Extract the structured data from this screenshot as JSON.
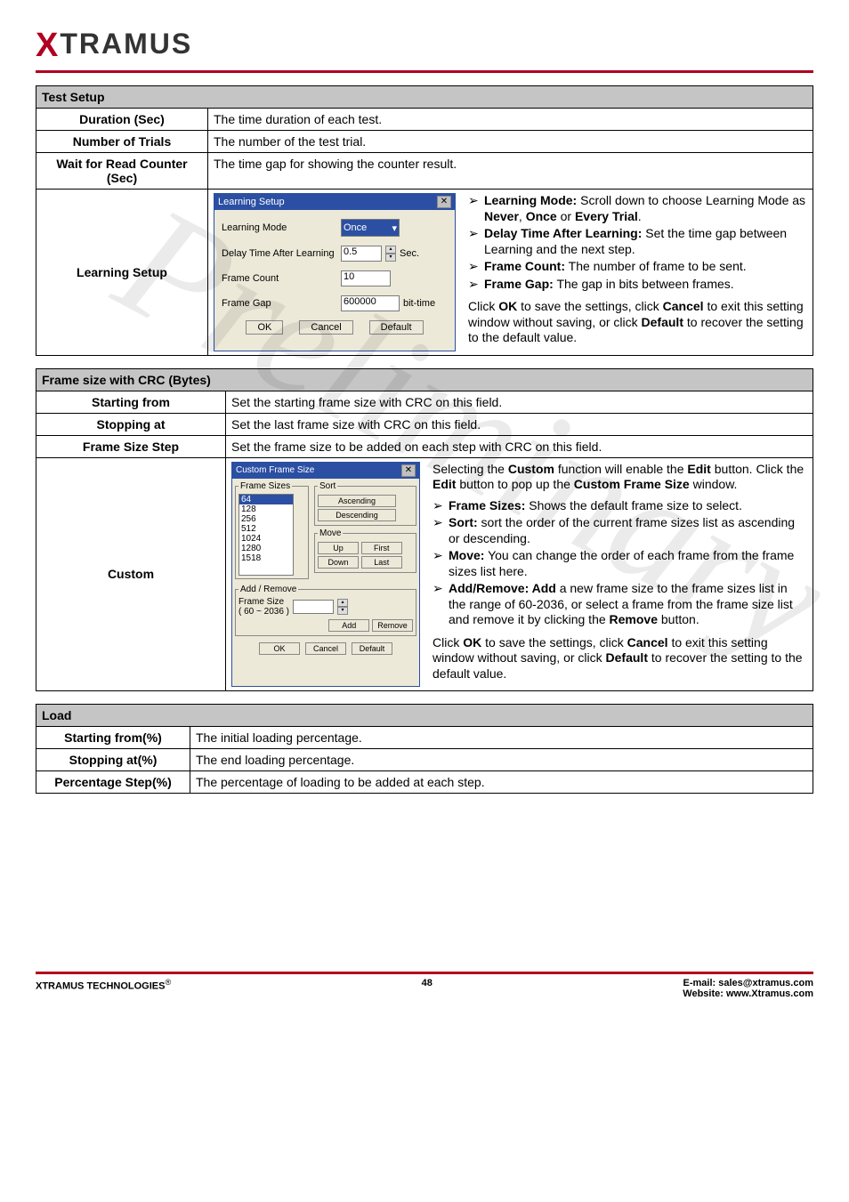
{
  "brand": {
    "prefix": "X",
    "rest": "TRAMUS"
  },
  "testSetup": {
    "header": "Test Setup",
    "rows": {
      "duration": {
        "label": "Duration (Sec)",
        "desc": "The time duration of each test."
      },
      "trials": {
        "label": "Number of Trials",
        "desc": "The number of the test trial."
      },
      "wait": {
        "label": "Wait for Read Counter (Sec)",
        "desc": "The time gap for showing the counter result."
      },
      "learning": {
        "label": "Learning Setup"
      }
    }
  },
  "learningDialog": {
    "title": "Learning Setup",
    "mode_label": "Learning Mode",
    "mode_value": "Once",
    "delay_label": "Delay Time After Learning",
    "delay_value": "0.5",
    "delay_unit": "Sec.",
    "framecount_label": "Frame Count",
    "framecount_value": "10",
    "framegap_label": "Frame Gap",
    "framegap_value": "600000",
    "framegap_unit": "bit-time",
    "ok": "OK",
    "cancel": "Cancel",
    "default": "Default"
  },
  "learningDesc": {
    "b1a": "Learning Mode:",
    "b1b": " Scroll down to choose Learning Mode as ",
    "b1c": "Never",
    "b1d": ", ",
    "b1e": "Once",
    "b1f": " or ",
    "b1g": "Every Trial",
    "b1h": ".",
    "b2a": "Delay Time After Learning:",
    "b2b": " Set the time gap between Learning and the next step.",
    "b3a": "Frame Count:",
    "b3b": " The number of frame to be sent.",
    "b4a": "Frame Gap:",
    "b4b": " The gap in bits between frames.",
    "p1a": "Click ",
    "p1b": "OK",
    "p1c": " to save the settings, click ",
    "p1d": "Cancel",
    "p1e": " to exit this setting window without saving, or click ",
    "p1f": "Default",
    "p1g": " to recover the setting to the default value."
  },
  "frameSize": {
    "header": "Frame size with CRC (Bytes)",
    "starting": {
      "label": "Starting from",
      "desc": "Set the starting frame size with CRC on this field."
    },
    "stopping": {
      "label": "Stopping at",
      "desc": "Set the last frame size with CRC on this field."
    },
    "step": {
      "label": "Frame Size Step",
      "desc": "Set the frame size to be added on each step with CRC on this field."
    },
    "custom": {
      "label": "Custom"
    }
  },
  "customDialog": {
    "title": "Custom Frame Size",
    "frameSizesLegend": "Frame Sizes",
    "list": [
      "64",
      "128",
      "256",
      "512",
      "1024",
      "1280",
      "1518"
    ],
    "sortLegend": "Sort",
    "asc": "Ascending",
    "desc": "Descending",
    "moveLegend": "Move",
    "up": "Up",
    "first": "First",
    "down": "Down",
    "last": "Last",
    "addRemoveLegend": "Add / Remove",
    "frameSizeLabel": "Frame Size",
    "range": "( 60 ~ 2036 )",
    "add": "Add",
    "remove": "Remove",
    "ok": "OK",
    "cancel": "Cancel",
    "default": "Default"
  },
  "customDesc": {
    "p1a": "Selecting the ",
    "p1b": "Custom",
    "p1c": " function will enable the ",
    "p1d": "Edit",
    "p1e": " button. Click the ",
    "p1f": "Edit",
    "p1g": " button to pop up the ",
    "p1h": "Custom Frame Size",
    "p1i": " window.",
    "b1a": "Frame Sizes:",
    "b1b": " Shows the default frame size to select.",
    "b2a": "Sort:",
    "b2b": " sort the order of the current frame sizes list as ascending or descending.",
    "b3a": "Move:",
    "b3b": " You can change the order of each frame from the frame sizes list here.",
    "b4a": "Add/Remove: Add",
    "b4b": " a new frame size to the frame sizes list in the range of 60-2036, or select a frame from the frame size list and remove it by clicking the ",
    "b4c": "Remove",
    "b4d": " button.",
    "p2a": "Click ",
    "p2b": "OK",
    "p2c": " to save the settings, click ",
    "p2d": "Cancel",
    "p2e": " to exit this setting window without saving, or click ",
    "p2f": "Default",
    "p2g": " to recover the setting to the default value."
  },
  "load": {
    "header": "Load",
    "starting": {
      "label": "Starting from(%)",
      "desc": "The initial loading percentage."
    },
    "stopping": {
      "label": "Stopping at(%)",
      "desc": "The end loading percentage."
    },
    "step": {
      "label": "Percentage Step(%)",
      "desc": "The percentage of loading to be added at each step."
    }
  },
  "watermark": "Preliminary",
  "footer": {
    "left": "XTRAMUS TECHNOLOGIES",
    "reg": "®",
    "page": "48",
    "email_label": "E-mail: ",
    "email": "sales@xtramus.com",
    "site_label": "Website:  ",
    "site": "www.Xtramus.com"
  }
}
